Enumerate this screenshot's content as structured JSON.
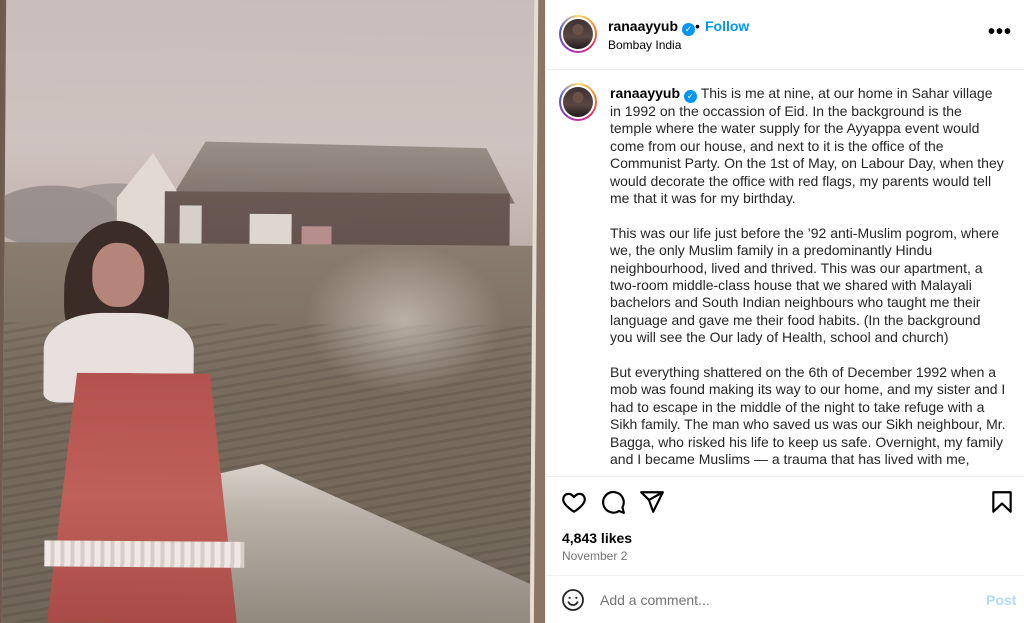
{
  "header": {
    "username": "ranaayyub",
    "verified_icon": "verified-badge-icon",
    "separator": "•",
    "follow_label": "Follow",
    "location": "Bombay India",
    "more_icon": "more-options-icon",
    "more_glyph": "•••"
  },
  "caption": {
    "username": "ranaayyub",
    "paragraphs": [
      "This is me at nine, at our home in Sahar village in 1992 on the occassion of Eid. In the background is the temple where the water supply for the Ayyappa event would come from our house, and next to it is the office of the Communist Party. On the 1st of May, on Labour Day, when they would decorate the office with red flags, my parents would tell me that it was for my birthday.",
      "This was our life just before the ’92 anti-Muslim pogrom, where we, the only Muslim family in a predominantly Hindu neighbourhood, lived and thrived. This was our apartment, a two-room middle-class house that we shared with Malayali bachelors and South Indian neighbours who taught me their language and gave me their food habits. (In the background you will see the Our lady of Health, school and church)",
      "But everything shattered on the 6th of December 1992 when a mob was found making its way to our home, and my sister and I had to escape in the middle of the night to take refuge with a Sikh family. The man who saved us was our Sikh neighbour, Mr. Bagga, who risked his life to keep us safe. Overnight, my family and I became Muslims — a trauma that has lived with me,"
    ]
  },
  "actions": {
    "like_icon": "heart-icon",
    "comment_icon": "comment-icon",
    "share_icon": "share-icon",
    "save_icon": "bookmark-icon",
    "likes": "4,843 likes",
    "date": "November 2"
  },
  "comment": {
    "emoji_icon": "emoji-icon",
    "placeholder": "Add a comment...",
    "post_label": "Post"
  },
  "colors": {
    "accent": "#0095f6",
    "post_disabled": "#b3dbff",
    "muted": "#737373"
  }
}
